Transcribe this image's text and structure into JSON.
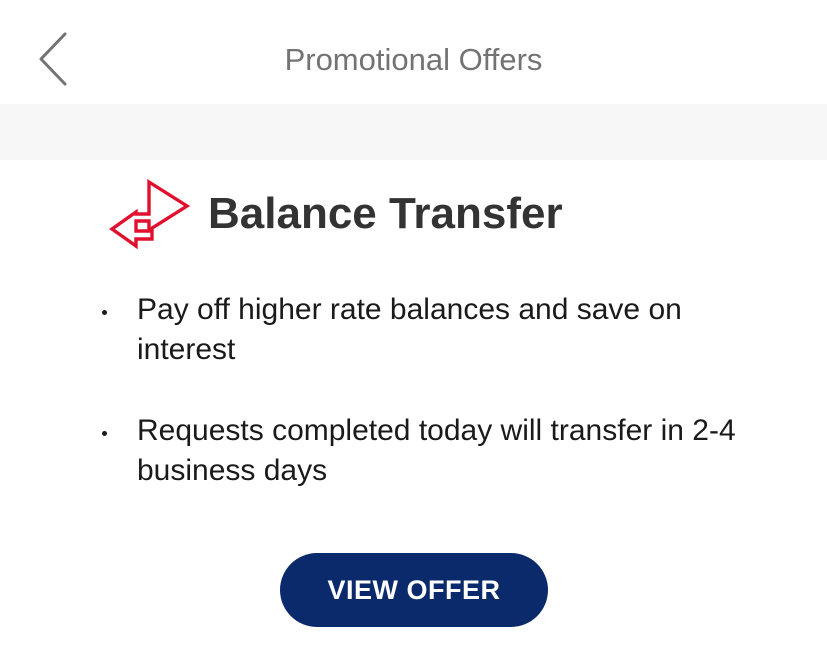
{
  "header": {
    "title": "Promotional Offers",
    "back_icon": "chevron-left-icon"
  },
  "offer": {
    "icon": "transfer-arrows-icon",
    "icon_color": "#e0102e",
    "title": "Balance Transfer",
    "bullets": [
      "Pay off higher rate balances and save on interest",
      "Requests completed today will transfer in 2-4 business days"
    ],
    "cta_label": "VIEW OFFER",
    "cta_color": "#0a2a6b"
  }
}
